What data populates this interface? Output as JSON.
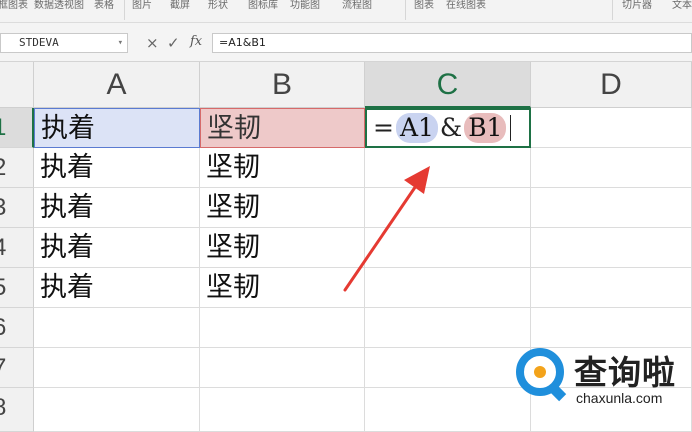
{
  "ribbon": {
    "items": [
      "框图表",
      "数据透视图",
      "表格",
      "图片",
      "截屏",
      "形状",
      "图标库",
      "功能图",
      "流程图",
      "图表",
      "在线图表",
      "切片器",
      "文本"
    ]
  },
  "formula_bar": {
    "name_box": "STDEVA",
    "cancel_glyph": "×",
    "enter_glyph": "✓",
    "fx_label": "fx",
    "formula": "=A1&B1"
  },
  "columns": [
    "A",
    "B",
    "C",
    "D"
  ],
  "rows": [
    "1",
    "2",
    "3",
    "4",
    "5",
    "6",
    "7",
    "8"
  ],
  "cells": {
    "A": [
      "执着",
      "执着",
      "执着",
      "执着",
      "执着"
    ],
    "B": [
      "坚韧",
      "坚韧",
      "坚韧",
      "坚韧",
      "坚韧"
    ]
  },
  "editing": {
    "eq": "=",
    "ref_a": "A1",
    "amp": "&",
    "ref_b": "B1"
  },
  "watermark": {
    "cn": "查询啦",
    "en": "chaxunla.com"
  },
  "colors": {
    "active_green": "#1e7145",
    "ref_a_fill": "#dce3f6",
    "ref_b_fill": "#eec9c9",
    "arrow_red": "#e53a32"
  }
}
